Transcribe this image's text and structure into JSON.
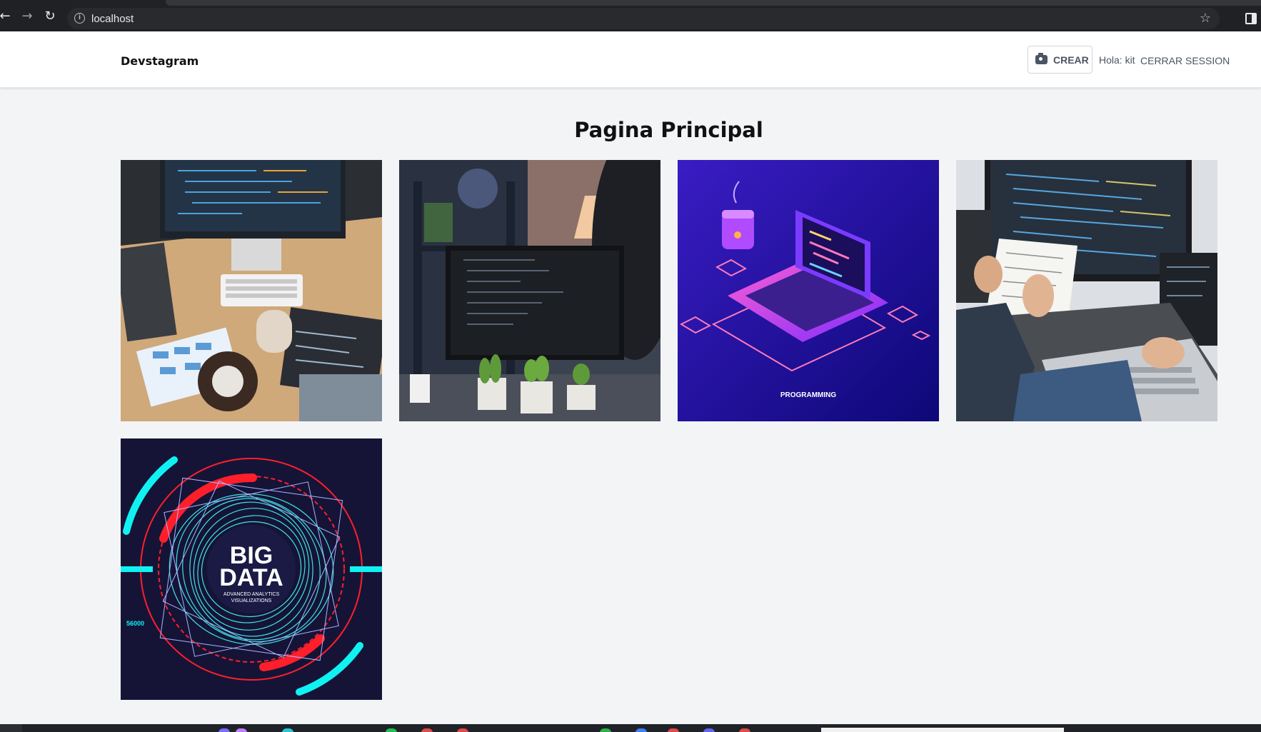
{
  "browser": {
    "url": "localhost",
    "back_icon": "arrow-left-icon",
    "forward_icon": "arrow-right-icon",
    "reload_icon": "reload-icon",
    "info_icon": "info-icon",
    "bookmark_icon": "star-icon"
  },
  "header": {
    "brand": "Devstagram",
    "create_label": "CREAR",
    "create_icon": "camera-icon",
    "greeting": "Hola: kit",
    "logout_label": "CERRAR SESSION"
  },
  "main": {
    "title": "Pagina Principal",
    "posts": [
      {
        "label": ""
      },
      {
        "label": ""
      },
      {
        "label": "PROGRAMMING"
      },
      {
        "label": ""
      },
      {
        "label": "BIG",
        "label2": "DATA",
        "caption": "ADVANCED ANALYTICS",
        "caption2": "VISUALIZATIONS",
        "corner": "56000"
      }
    ]
  },
  "colors": {
    "page_bg": "#f3f4f6",
    "header_bg": "#ffffff",
    "text_muted": "#4b5563",
    "chrome_bg": "#202124"
  }
}
